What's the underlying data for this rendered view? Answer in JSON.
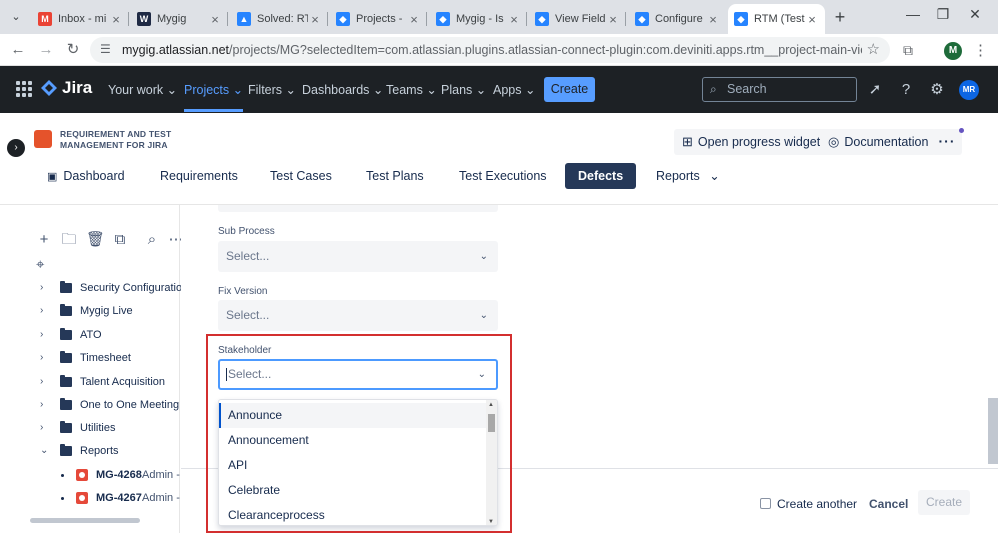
{
  "browser": {
    "tabs": [
      {
        "title": "Inbox - mi",
        "icon": "gmail-icon",
        "color": "#ea4335",
        "glyph": "M"
      },
      {
        "title": "Mygig",
        "icon": "mygig-icon",
        "color": "#1f2a44",
        "glyph": "W"
      },
      {
        "title": "Solved: RT",
        "icon": "atlassian-icon",
        "color": "#2684ff",
        "glyph": "▲"
      },
      {
        "title": "Projects - ",
        "icon": "jira-icon",
        "color": "#2684ff",
        "glyph": "◆"
      },
      {
        "title": "Mygig - Is",
        "icon": "jira-icon",
        "color": "#2684ff",
        "glyph": "◆"
      },
      {
        "title": "View Field",
        "icon": "jira-icon",
        "color": "#2684ff",
        "glyph": "◆"
      },
      {
        "title": "Configure ",
        "icon": "jira-icon",
        "color": "#2684ff",
        "glyph": "◆"
      },
      {
        "title": "RTM (Test",
        "icon": "jira-icon",
        "color": "#2684ff",
        "glyph": "◆"
      }
    ],
    "url_host": "mygig.atlassian.net",
    "url_path": "/projects/MG?selectedItem=com.atlassian.plugins.atlassian-connect-plugin:com.deviniti.apps.rtm__project-main-view#!/def...",
    "profile_initial": "M"
  },
  "jira": {
    "product": "Jira",
    "menu": [
      {
        "label": "Your work",
        "caret": "⌄"
      },
      {
        "label": "Projects",
        "caret": "⌄"
      },
      {
        "label": "Filters",
        "caret": "⌄"
      },
      {
        "label": "Dashboards",
        "caret": "⌄"
      },
      {
        "label": "Teams",
        "caret": "⌄"
      },
      {
        "label": "Plans",
        "caret": "⌄"
      },
      {
        "label": "Apps",
        "caret": "⌄"
      }
    ],
    "create_label": "Create",
    "search_placeholder": "Search",
    "avatar_initials": "MR"
  },
  "app": {
    "title": "REQUIREMENT AND TEST MANAGEMENT FOR JIRA",
    "open_progress_widget": "Open progress widget",
    "documentation": "Documentation",
    "more": "···",
    "nav": [
      "Dashboard",
      "Requirements",
      "Test Cases",
      "Test Plans",
      "Test Executions",
      "Defects",
      "Reports"
    ],
    "selected_nav": "Defects"
  },
  "sidebar": {
    "folders": [
      "Security Configuration",
      "Mygig Live",
      "ATO",
      "Timesheet",
      "Talent Acquisition",
      "One to One Meeting",
      "Utilities",
      "Reports"
    ],
    "issues": [
      {
        "key": "MG-4268",
        "summary": "Admin -"
      },
      {
        "key": "MG-4267",
        "summary": "Admin -"
      }
    ]
  },
  "form": {
    "sub_process_label": "Sub Process",
    "fix_version_label": "Fix Version",
    "stakeholder_label": "Stakeholder",
    "placeholder": "Select...",
    "options": [
      "Announce",
      "Announcement",
      "API",
      "Celebrate",
      "Clearanceprocess"
    ],
    "create_another": "Create another",
    "cancel": "Cancel",
    "create": "Create"
  },
  "colors": {
    "jira_nav_bg": "#1d2125",
    "accent_blue": "#579dff",
    "selected_tab_bg": "#253858",
    "highlight_box": "#d32f2f"
  }
}
